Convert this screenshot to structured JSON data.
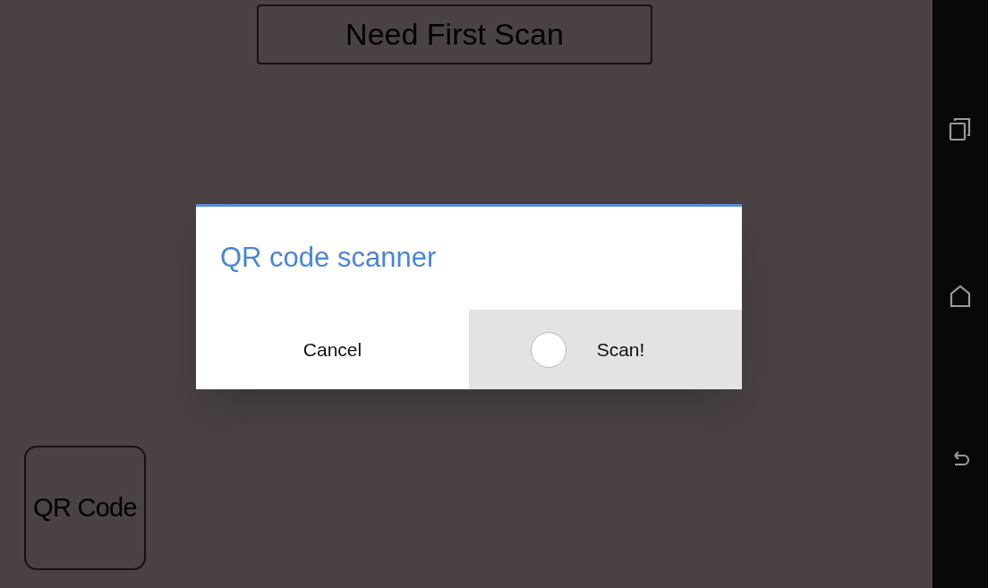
{
  "app": {
    "status_button": "Need First Scan",
    "qr_button": "QR Code"
  },
  "dialog": {
    "title": "QR code scanner",
    "buttons": [
      {
        "label": "Cancel",
        "pressed": false
      },
      {
        "label": "Scan!",
        "pressed": true
      }
    ]
  }
}
